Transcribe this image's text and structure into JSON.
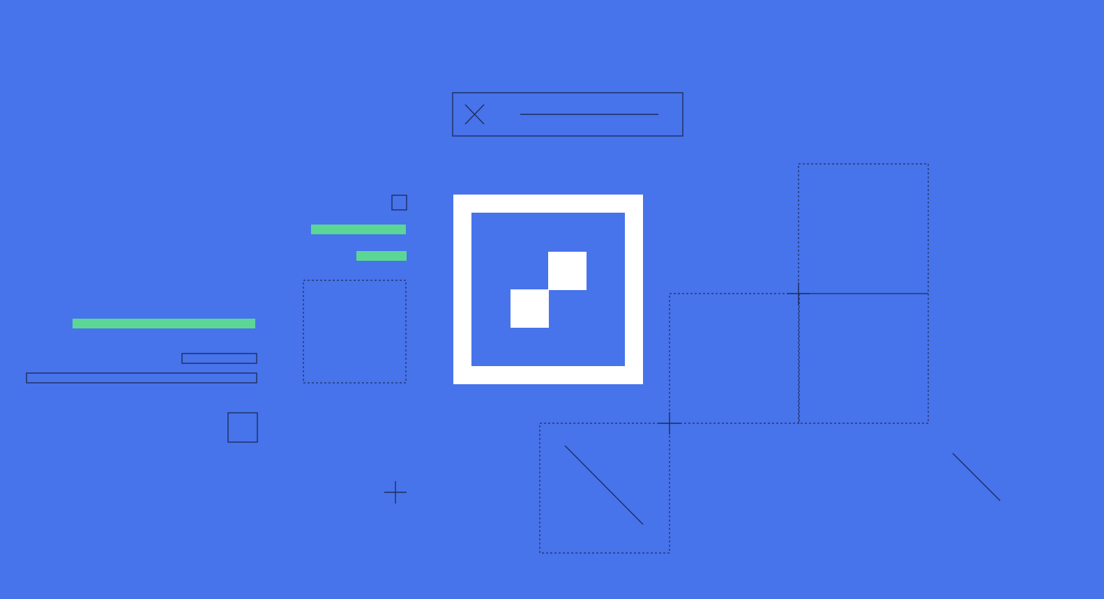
{
  "colors": {
    "background": "#4773EB",
    "accent_green": "#5CD694",
    "logo_white": "#FFFFFF",
    "outline_dark": "#1E2D5A"
  },
  "icons": {
    "close": "close-icon",
    "logo": "two-square-logo-icon",
    "crosshair": "plus-crosshair-icon"
  }
}
